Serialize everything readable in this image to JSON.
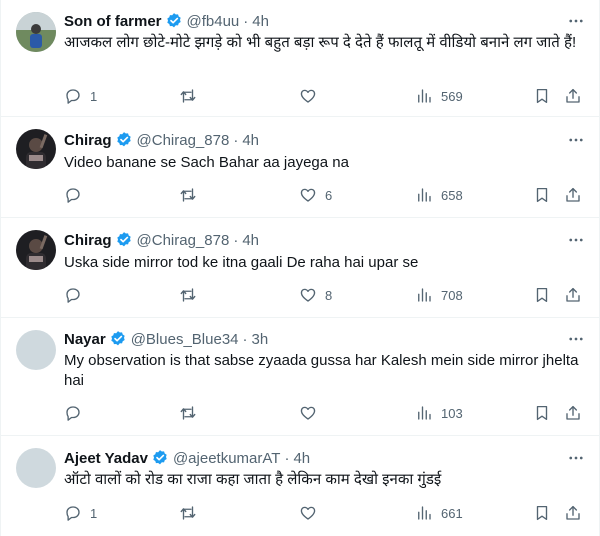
{
  "accent": "#1d9bf0",
  "icons": {
    "reply": "reply-icon",
    "retweet": "retweet-icon",
    "like": "heart-icon",
    "views": "views-icon",
    "bookmark": "bookmark-icon",
    "share": "share-icon",
    "verified": "verified-badge-icon",
    "more": "more-dots-icon"
  },
  "tweets": [
    {
      "name": "Son of farmer",
      "handle": "@fb4uu",
      "time": "4h",
      "text": "आजकल लोग छोटे-मोटे झगड़े को भी बहुत बड़ा रूप दे देते हैं फालतू में वीडियो बनाने लग जाते हैं!",
      "replies": "1",
      "retweets": "",
      "likes": "",
      "views": "569"
    },
    {
      "name": "Chirag",
      "handle": "@Chirag_878",
      "time": "4h",
      "text": "Video banane se Sach Bahar aa jayega na",
      "replies": "",
      "retweets": "",
      "likes": "6",
      "views": "658"
    },
    {
      "name": "Chirag",
      "handle": "@Chirag_878",
      "time": "4h",
      "text": "Uska side mirror tod ke itna gaali De raha hai upar se",
      "replies": "",
      "retweets": "",
      "likes": "8",
      "views": "708"
    },
    {
      "name": "Nayar",
      "handle": "@Blues_Blue34",
      "time": "3h",
      "text": "My observation is that sabse zyaada gussa har Kalesh mein side mirror jhelta hai",
      "replies": "",
      "retweets": "",
      "likes": "",
      "views": "103"
    },
    {
      "name": "Ajeet Yadav",
      "handle": "@ajeetkumarAT",
      "time": "4h",
      "text": "ऑटो वालों को रोड का राजा कहा जाता है लेकिन काम देखो इनका गुंडई",
      "replies": "1",
      "retweets": "",
      "likes": "",
      "views": "661"
    }
  ]
}
